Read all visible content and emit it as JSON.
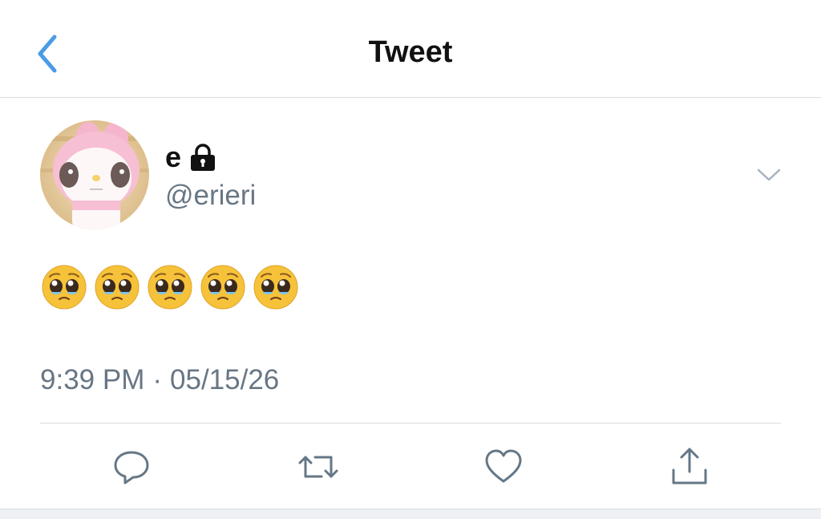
{
  "nav": {
    "title": "Tweet",
    "back_icon": "chevron-left-icon"
  },
  "tweet": {
    "author": {
      "name": "e",
      "handle": "@erieri",
      "locked_icon": "lock-icon",
      "avatar": "avatar-image"
    },
    "text": "🥺🥺🥺🥺🥺",
    "time": "9:39 PM",
    "separator": "·",
    "date": "05/15/26",
    "more_icon": "chevron-down-icon"
  },
  "actions": [
    {
      "name": "reply",
      "icon": "reply-icon"
    },
    {
      "name": "retweet",
      "icon": "retweet-icon"
    },
    {
      "name": "like",
      "icon": "heart-icon"
    },
    {
      "name": "share",
      "icon": "share-icon"
    }
  ],
  "colors": {
    "accent": "#4a9be6",
    "secondary_text": "#687684",
    "divider": "#d8dde2",
    "icon": "#657786"
  }
}
